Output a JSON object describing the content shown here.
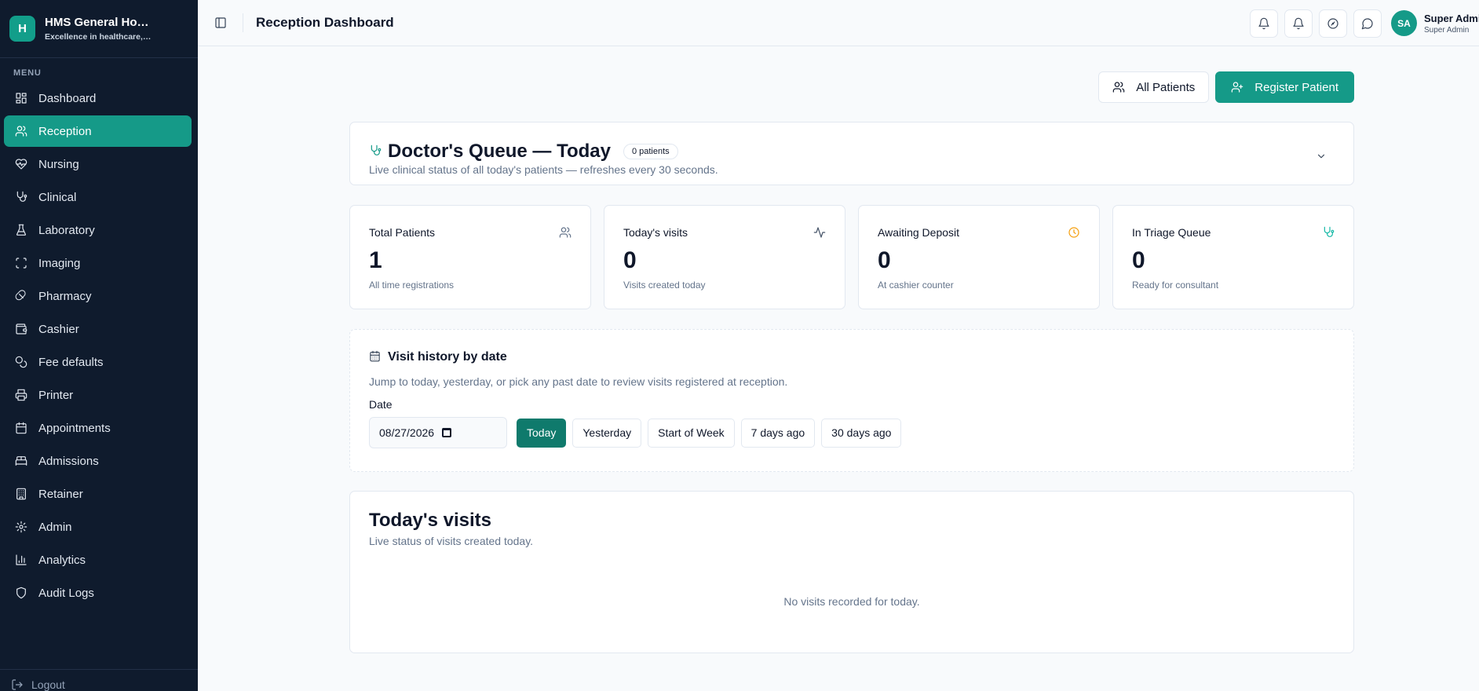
{
  "app": {
    "logo_letter": "H",
    "name": "HMS General Ho…",
    "tagline": "Excellence in healthcare,…"
  },
  "sidebar": {
    "heading": "MENU",
    "items": [
      {
        "label": "Dashboard",
        "icon": "dashboard-icon"
      },
      {
        "label": "Reception",
        "icon": "users-icon",
        "active": true
      },
      {
        "label": "Nursing",
        "icon": "heart-pulse-icon"
      },
      {
        "label": "Clinical",
        "icon": "stethoscope-icon"
      },
      {
        "label": "Laboratory",
        "icon": "flask-icon"
      },
      {
        "label": "Imaging",
        "icon": "scan-icon"
      },
      {
        "label": "Pharmacy",
        "icon": "pill-icon"
      },
      {
        "label": "Cashier",
        "icon": "wallet-icon"
      },
      {
        "label": "Fee defaults",
        "icon": "coins-icon"
      },
      {
        "label": "Printer",
        "icon": "printer-icon"
      },
      {
        "label": "Appointments",
        "icon": "calendar-icon"
      },
      {
        "label": "Admissions",
        "icon": "bed-icon"
      },
      {
        "label": "Retainer",
        "icon": "building-icon"
      },
      {
        "label": "Admin",
        "icon": "gear-icon"
      },
      {
        "label": "Analytics",
        "icon": "bar-chart-icon"
      },
      {
        "label": "Audit Logs",
        "icon": "shield-icon"
      }
    ],
    "logout_label": "Logout"
  },
  "topbar": {
    "title": "Reception Dashboard",
    "user": {
      "initials": "SA",
      "name": "Super Admin",
      "role": "Super Admin"
    }
  },
  "actions": {
    "all_patients": "All Patients",
    "register_patient": "Register Patient"
  },
  "queue": {
    "title": "Doctor's Queue — Today",
    "badge": "0 patients",
    "subtitle": "Live clinical status of all today's patients — refreshes every 30 seconds."
  },
  "stats": [
    {
      "label": "Total Patients",
      "value": "1",
      "sub": "All time registrations",
      "icon": "users-icon",
      "color": "#64748b"
    },
    {
      "label": "Today's visits",
      "value": "0",
      "sub": "Visits created today",
      "icon": "activity-icon",
      "color": "#475569"
    },
    {
      "label": "Awaiting Deposit",
      "value": "0",
      "sub": "At cashier counter",
      "icon": "clock-icon",
      "color": "#f59e0b"
    },
    {
      "label": "In Triage Queue",
      "value": "0",
      "sub": "Ready for consultant",
      "icon": "stethoscope-icon",
      "color": "#14b8a6"
    }
  ],
  "history": {
    "title": "Visit history by date",
    "subtitle": "Jump to today, yesterday, or pick any past date to review visits registered at reception.",
    "date_label": "Date",
    "date_value": "08/27/2026",
    "quick": [
      "Today",
      "Yesterday",
      "Start of Week",
      "7 days ago",
      "30 days ago"
    ]
  },
  "visits": {
    "title": "Today's visits",
    "subtitle": "Live status of visits created today.",
    "empty": "No visits recorded for today."
  },
  "colors": {
    "accent": "#159a88",
    "sidebar_bg": "#0f1b2d"
  }
}
